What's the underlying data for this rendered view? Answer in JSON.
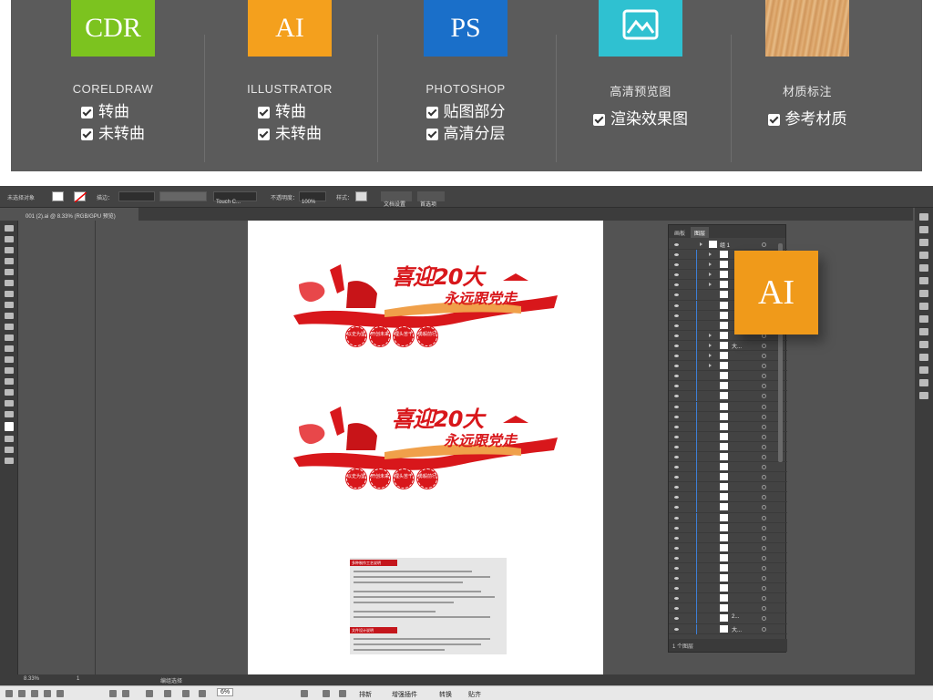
{
  "formats": [
    {
      "tile": "CDR",
      "color": "#7cc31f",
      "title": "CORELDRAW",
      "checks": [
        "转曲",
        "未转曲"
      ]
    },
    {
      "tile": "AI",
      "color": "#f4a01d",
      "title": "ILLUSTRATOR",
      "checks": [
        "转曲",
        "未转曲"
      ]
    },
    {
      "tile": "PS",
      "color": "#1a6fc9",
      "title": "PHOTOSHOP",
      "checks": [
        "贴图部分",
        "高清分层"
      ]
    },
    {
      "tile": "",
      "color": "#2fc1d1",
      "title": "高清预览图",
      "checks": [
        "渲染效果图"
      ],
      "icon": "image-icon"
    },
    {
      "tile": "",
      "color": "#d9a36a",
      "title": "材质标注",
      "checks": [
        "参考材质"
      ],
      "icon": "wood-texture"
    }
  ],
  "control_bar": {
    "selection": "未选择对象",
    "stroke_label": "描边：",
    "brush": "Touch C...",
    "opacity_label": "不透明度：",
    "opacity_value": "100%",
    "style_label": "样式：",
    "doc_settings": "文档设置",
    "preferences": "首选项"
  },
  "document_tab": "001 (2).ai @ 8.33% (RGB/GPU 预览)",
  "artwork": {
    "headline": "喜迎20大",
    "subline": "永远跟党走",
    "badges": [
      "以史为鉴",
      "开创未来",
      "埋头苦干",
      "勇毅前行"
    ],
    "spec_header_1": "多种制作工艺说明",
    "spec_header_2": "文件设计说明"
  },
  "layers_panel": {
    "tabs": [
      "画板",
      "图层"
    ],
    "top_layer": "组 1",
    "footer": "1 个图层",
    "row_names": [
      "",
      "",
      "",
      "",
      "",
      "",
      "",
      "",
      "",
      "大...",
      "",
      "",
      "",
      "",
      "",
      "",
      "",
      "",
      "",
      "",
      "",
      "",
      "",
      "",
      "",
      "",
      "",
      "",
      "",
      "",
      "",
      "",
      "",
      "",
      "",
      "",
      "2...",
      "大..."
    ]
  },
  "status_bar": {
    "zoom": "8.33%",
    "page": "1",
    "tool": "编组选择"
  },
  "taskbar": {
    "zoom": "6%",
    "items": [
      "排新",
      "增强插件",
      "转换",
      "贴齐"
    ]
  },
  "ai_badge": "AI"
}
